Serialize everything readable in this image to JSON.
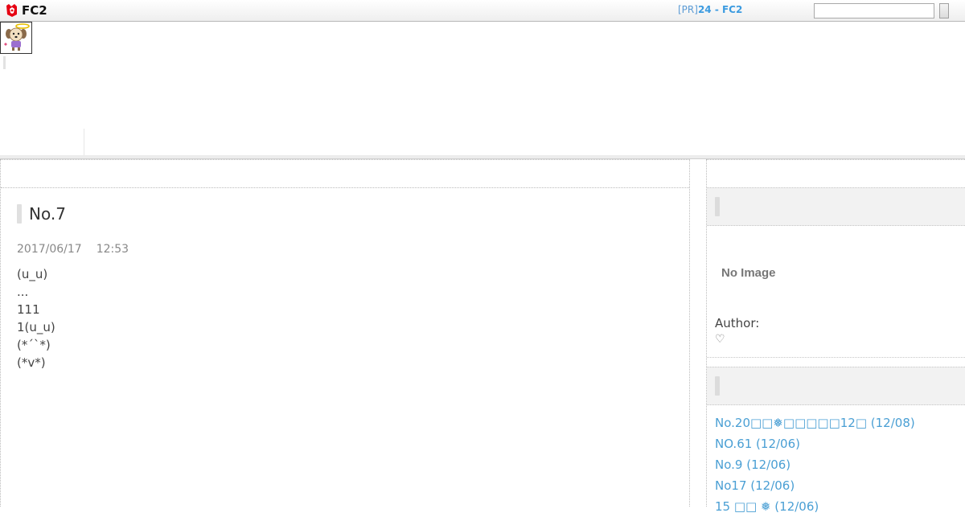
{
  "topbar": {
    "logo_text": "FC2",
    "pr_tag": "[PR]",
    "pr_text": "24 - FC2",
    "search_value": "",
    "search_button_label": ""
  },
  "article": {
    "title": "No.7",
    "date": "2017/06/17",
    "time": "12:53",
    "body_lines": [
      "(u_u)",
      "",
      "",
      "...",
      "",
      "111",
      "",
      "1(u_u)",
      "",
      "",
      "(*´`*)",
      "",
      "(*v*)"
    ]
  },
  "sidebar": {
    "profile": {
      "no_image_text": "No Image",
      "author_label": "Author:",
      "author_name": "♡"
    },
    "recent_entries": [
      "No.20□□❅□□□□□12□ (12/08)",
      "NO.61  (12/06)",
      "No.9  (12/06)",
      "No17  (12/06)",
      "15 □□ ❅ (12/06)"
    ]
  },
  "colors": {
    "link": "#4a9fd4",
    "pr_link": "#3c9be0",
    "sidebar_header_bg": "#f2f2f2"
  },
  "icons": {
    "logo": "fc2-fox-logo-icon",
    "avatar": "angel-dog-avatar"
  }
}
